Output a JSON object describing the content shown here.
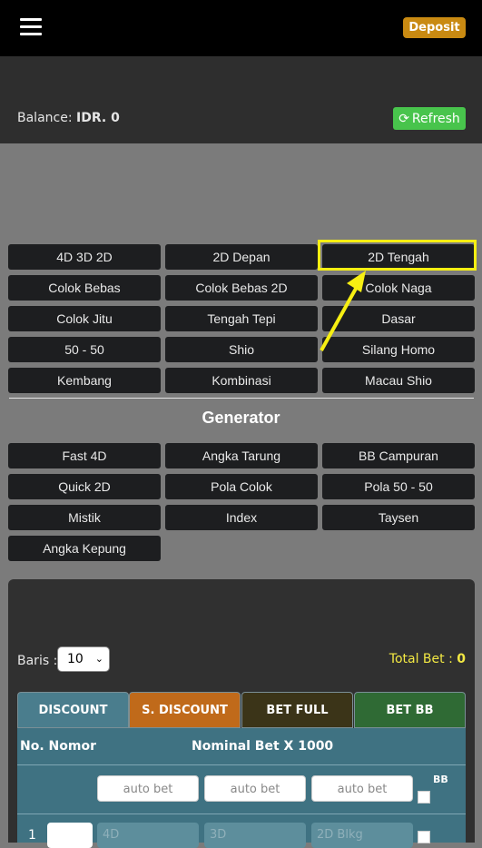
{
  "header": {
    "deposit_label": "Deposit"
  },
  "balance": {
    "label": "Balance:",
    "value": "IDR. 0"
  },
  "refresh_label": "Refresh",
  "games": [
    "4D 3D 2D",
    "2D Depan",
    "2D Tengah",
    "Colok Bebas",
    "Colok Bebas 2D",
    "Colok Naga",
    "Colok Jitu",
    "Tengah Tepi",
    "Dasar",
    "50 - 50",
    "Shio",
    "Silang Homo",
    "Kembang",
    "Kombinasi",
    "Macau Shio"
  ],
  "generator": {
    "title": "Generator",
    "items": [
      "Fast 4D",
      "Angka Tarung",
      "BB Campuran",
      "Quick 2D",
      "Pola Colok",
      "Pola 50 - 50",
      "Mistik",
      "Index",
      "Taysen",
      "Angka Kepung"
    ]
  },
  "bet_panel": {
    "baris_label": "Baris :",
    "baris_value": "10",
    "total_label": "Total Bet :",
    "total_value": "0",
    "tabs": [
      "DISCOUNT",
      "S. DISCOUNT",
      "BET FULL",
      "BET BB"
    ],
    "col_no": "No. Nomor",
    "col_nominal": "Nominal Bet X 1000",
    "auto_placeholder": "auto bet",
    "bb_label": "BB",
    "rows": [
      {
        "num": "1",
        "placeholders": [
          "4D",
          "3D",
          "2D Blkg"
        ]
      }
    ]
  },
  "colors": {
    "highlight": "#f7ef12",
    "arrow": "#f7ef12",
    "deposit": "#c98a12",
    "refresh": "#48c44c",
    "tab_discount": "#4a7d8d",
    "tab_sdiscount": "#c06a1a",
    "tab_betfull": "#3b3418",
    "tab_betbb": "#2f6a34"
  }
}
